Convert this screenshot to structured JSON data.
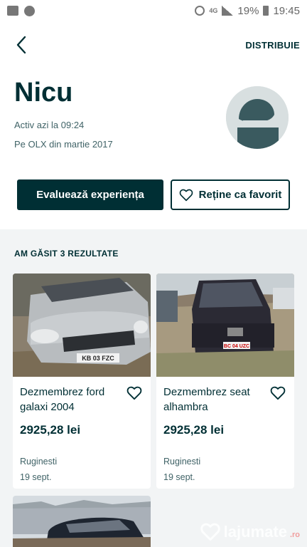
{
  "status_bar": {
    "network": "4G",
    "battery": "19%",
    "time": "19:45"
  },
  "nav": {
    "share_label": "DISTRIBUIE"
  },
  "profile": {
    "name": "Nicu",
    "active": "Activ azi la 09:24",
    "since": "Pe OLX din martie 2017"
  },
  "actions": {
    "rate_label": "Evaluează experiența",
    "favorite_label": "Reține ca favorit"
  },
  "results": {
    "title": "AM GĂSIT 3 REZULTATE",
    "items": [
      {
        "title": "Dezmembrez ford galaxi 2004",
        "price": "2925,28 lei",
        "location": "Ruginesti",
        "date": "19 sept.",
        "plate": "KB 03 FZC"
      },
      {
        "title": "Dezmembrez seat alhambra",
        "price": "2925,28 lei",
        "location": "Ruginesti",
        "date": "19 sept.",
        "plate": "BC 04 UZC"
      },
      {
        "title": ""
      }
    ]
  },
  "watermark": {
    "text": "lajumate",
    "tld": ".ro"
  },
  "colors": {
    "primary": "#002f34",
    "secondary_text": "#406367",
    "results_bg": "#f2f4f5",
    "avatar_bg": "#d8dfe0",
    "avatar_fg": "#3a5a5f"
  }
}
